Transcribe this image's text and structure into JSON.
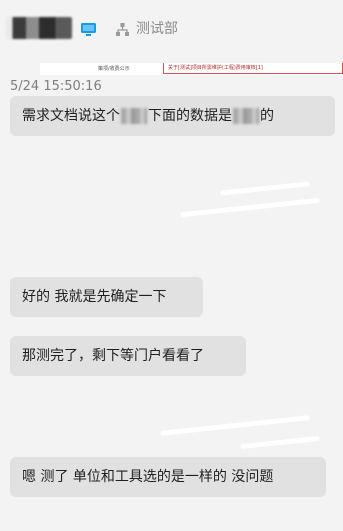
{
  "header": {
    "department": "测试部",
    "icons": {
      "monitor": "monitor-icon",
      "org": "org-chart-icon"
    },
    "accent_color": "#1a9bea"
  },
  "doc_preview": {
    "cell_a": "策项/收费公示",
    "cell_b": "关于[测试]项目所需维护(工程)费用审核[1]"
  },
  "timestamp": "5/24 15:50:16",
  "messages": [
    {
      "part1": "需求文档说这个",
      "part2": "下面的数据是",
      "part3": "的"
    },
    {
      "text": "好的 我就是先确定一下"
    },
    {
      "text": "那测完了，剩下等门户看看了"
    },
    {
      "text": "嗯 测了 单位和工具选的是一样的 没问题"
    }
  ]
}
